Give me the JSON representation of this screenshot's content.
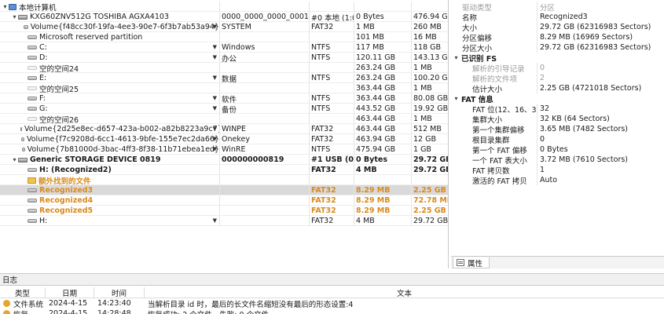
{
  "tree": {
    "rows": [
      {
        "level": 0,
        "caret": "▾",
        "icon": "computer",
        "name": "本地计算机",
        "label": "",
        "fs": "",
        "size": "",
        "total": "",
        "style": ""
      },
      {
        "level": 1,
        "caret": "▾",
        "icon": "disk",
        "name": "KXG60ZNV512G TOSHIBA AGXA4103",
        "label": "0000_0000_0000_0001_...",
        "fs": "#0 本地 (1:0)",
        "size": "0 Bytes",
        "total": "476.94 GB",
        "style": ""
      },
      {
        "level": 2,
        "caret": "",
        "icon": "partition",
        "name": "Volume{f48cc30f-19fa-4ee3-90e7-6f3b7ab53a94}",
        "dropdown": true,
        "label": "SYSTEM",
        "fs": "FAT32",
        "size": "1 MB",
        "total": "260 MB",
        "style": ""
      },
      {
        "level": 2,
        "caret": "",
        "icon": "partition",
        "name": "Microsoft reserved partition",
        "dropdown": false,
        "label": "",
        "fs": "",
        "size": "101 MB",
        "total": "16 MB",
        "style": ""
      },
      {
        "level": 2,
        "caret": "",
        "icon": "partition",
        "name": "C:",
        "dropdown": true,
        "label": "Windows",
        "fs": "NTFS",
        "size": "117 MB",
        "total": "118 GB",
        "style": ""
      },
      {
        "level": 2,
        "caret": "",
        "icon": "partition",
        "name": "D:",
        "dropdown": true,
        "label": "办公",
        "fs": "NTFS",
        "size": "120.11 GB",
        "total": "143.13 GB",
        "style": ""
      },
      {
        "level": 2,
        "caret": "",
        "icon": "empty",
        "name": "空的空间24",
        "dropdown": false,
        "label": "",
        "fs": "",
        "size": "263.24 GB",
        "total": "1 MB",
        "style": ""
      },
      {
        "level": 2,
        "caret": "",
        "icon": "partition",
        "name": "E:",
        "dropdown": true,
        "label": "数据",
        "fs": "NTFS",
        "size": "263.24 GB",
        "total": "100.20 GB",
        "style": ""
      },
      {
        "level": 2,
        "caret": "",
        "icon": "empty",
        "name": "空的空间25",
        "dropdown": false,
        "label": "",
        "fs": "",
        "size": "363.44 GB",
        "total": "1 MB",
        "style": ""
      },
      {
        "level": 2,
        "caret": "",
        "icon": "partition",
        "name": "F:",
        "dropdown": true,
        "label": "软件",
        "fs": "NTFS",
        "size": "363.44 GB",
        "total": "80.08 GB",
        "style": ""
      },
      {
        "level": 2,
        "caret": "",
        "icon": "partition",
        "name": "G:",
        "dropdown": true,
        "label": "备份",
        "fs": "NTFS",
        "size": "443.52 GB",
        "total": "19.92 GB",
        "style": ""
      },
      {
        "level": 2,
        "caret": "",
        "icon": "empty",
        "name": "空的空间26",
        "dropdown": false,
        "label": "",
        "fs": "",
        "size": "463.44 GB",
        "total": "1 MB",
        "style": ""
      },
      {
        "level": 2,
        "caret": "",
        "icon": "partition",
        "name": "Volume{2d25e8ec-d657-423a-b002-a82b8223a9c7}",
        "dropdown": true,
        "label": "WINPE",
        "fs": "FAT32",
        "size": "463.44 GB",
        "total": "512 MB",
        "style": ""
      },
      {
        "level": 2,
        "caret": "",
        "icon": "partition",
        "name": "Volume{f7c9208d-6cc1-4613-9bfe-155e7ec2da66}",
        "dropdown": true,
        "label": "Onekey",
        "fs": "FAT32",
        "size": "463.94 GB",
        "total": "12 GB",
        "style": ""
      },
      {
        "level": 2,
        "caret": "",
        "icon": "partition",
        "name": "Volume{7b81000d-3bac-4ff3-8f38-11b71ebea1ed}",
        "dropdown": true,
        "label": "WinRE",
        "fs": "NTFS",
        "size": "475.94 GB",
        "total": "1 GB",
        "style": ""
      },
      {
        "level": 1,
        "caret": "▾",
        "icon": "disk",
        "name": "Generic STORAGE DEVICE 0819",
        "dropdown": false,
        "label": "000000000819",
        "fs": "#1 USB (0...",
        "size": "0 Bytes",
        "total": "29.72 GB",
        "style": "bold"
      },
      {
        "level": 2,
        "caret": "",
        "icon": "partition",
        "name": "H: (Recognized2)",
        "dropdown": false,
        "label": "",
        "fs": "FAT32",
        "size": "4 MB",
        "total": "29.72 GB",
        "style": "bold"
      },
      {
        "level": 2,
        "caret": "",
        "icon": "folder",
        "name": "额外找到的文件",
        "dropdown": false,
        "label": "",
        "fs": "",
        "size": "",
        "total": "",
        "style": "orange"
      },
      {
        "level": 2,
        "caret": "",
        "icon": "partition",
        "name": "Recognized3",
        "dropdown": false,
        "label": "",
        "fs": "FAT32",
        "size": "8.29 MB",
        "total": "2.25 GB",
        "style": "orange",
        "selected": true
      },
      {
        "level": 2,
        "caret": "",
        "icon": "partition",
        "name": "Recognized4",
        "dropdown": false,
        "label": "",
        "fs": "FAT32",
        "size": "8.29 MB",
        "total": "72.78 MB",
        "style": "orange"
      },
      {
        "level": 2,
        "caret": "",
        "icon": "partition",
        "name": "Recognized5",
        "dropdown": false,
        "label": "",
        "fs": "FAT32",
        "size": "8.29 MB",
        "total": "2.25 GB",
        "style": "orange"
      },
      {
        "level": 2,
        "caret": "",
        "icon": "partition",
        "name": "H:",
        "dropdown": true,
        "label": "",
        "fs": "FAT32",
        "size": "4 MB",
        "total": "29.72 GB",
        "style": ""
      }
    ]
  },
  "properties": {
    "basic": [
      {
        "key": "驱动类型",
        "value": "分区",
        "gray": true
      },
      {
        "key": "名称",
        "value": "Recognized3",
        "gray": false
      },
      {
        "key": "大小",
        "value": "29.72 GB (62316983 Sectors)",
        "gray": false
      },
      {
        "key": "分区偏移",
        "value": "8.29 MB (16969 Sectors)",
        "gray": false
      },
      {
        "key": "分区大小",
        "value": "29.72 GB (62316983 Sectors)",
        "gray": false
      }
    ],
    "groups": [
      {
        "title": "已识别 FS",
        "items": [
          {
            "key": "解析的引导记录",
            "value": "0",
            "gray": true
          },
          {
            "key": "解析的文件项",
            "value": "2",
            "gray": true
          },
          {
            "key": "估计大小",
            "value": "2.25 GB (4721018 Sectors)",
            "gray": false
          }
        ]
      },
      {
        "title": "FAT 信息",
        "items": [
          {
            "key": "FAT 位(12、16、32)",
            "value": "32",
            "gray": false
          },
          {
            "key": "集群大小",
            "value": "32 KB (64 Sectors)",
            "gray": false
          },
          {
            "key": "第一个集群偏移",
            "value": "3.65 MB (7482 Sectors)",
            "gray": false
          },
          {
            "key": "根目录集群",
            "value": "0",
            "gray": false
          },
          {
            "key": "第一个 FAT 偏移",
            "value": "0 Bytes",
            "gray": false
          },
          {
            "key": "一个 FAT 表大小",
            "value": "3.72 MB (7610 Sectors)",
            "gray": false
          },
          {
            "key": "FAT 拷贝数",
            "value": "1",
            "gray": false
          },
          {
            "key": "激活的 FAT 拷贝",
            "value": "Auto",
            "gray": false
          }
        ]
      }
    ],
    "tab_label": "属性"
  },
  "log": {
    "title": "日志",
    "columns": {
      "type": "类型",
      "date": "日期",
      "time": "时间",
      "text": "文本"
    },
    "rows": [
      {
        "type": "文件系统",
        "date": "2024-4-15",
        "time": "14:23:40",
        "text": "当解析目录 id 时，最后的长文件名缩短没有最后的形态设置:4"
      },
      {
        "type": "恢复",
        "date": "2024-4-15",
        "time": "14:28:48",
        "text": "恢复成功: 2 个文件。失败: 0 个文件。"
      }
    ]
  }
}
